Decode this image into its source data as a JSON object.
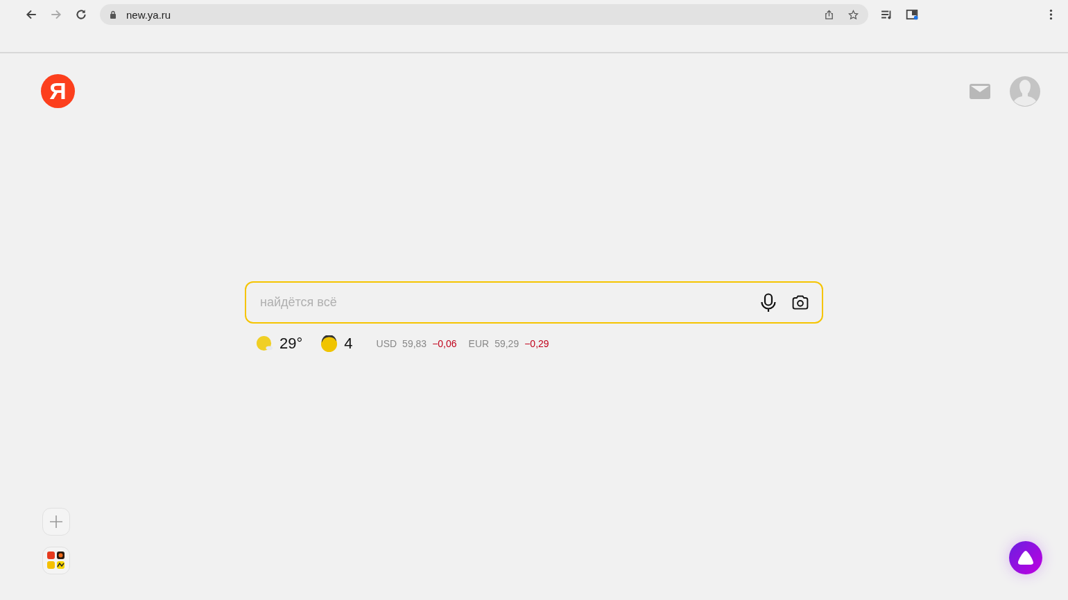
{
  "browser": {
    "url": "new.ya.ru"
  },
  "logo": {
    "letter": "Я"
  },
  "search": {
    "placeholder": "найдётся всё"
  },
  "weather": {
    "temperature": "29°"
  },
  "traffic": {
    "score": "4"
  },
  "rates": [
    {
      "currency": "USD",
      "value": "59,83",
      "change": "−0,06"
    },
    {
      "currency": "EUR",
      "value": "59,29",
      "change": "−0,29"
    }
  ]
}
